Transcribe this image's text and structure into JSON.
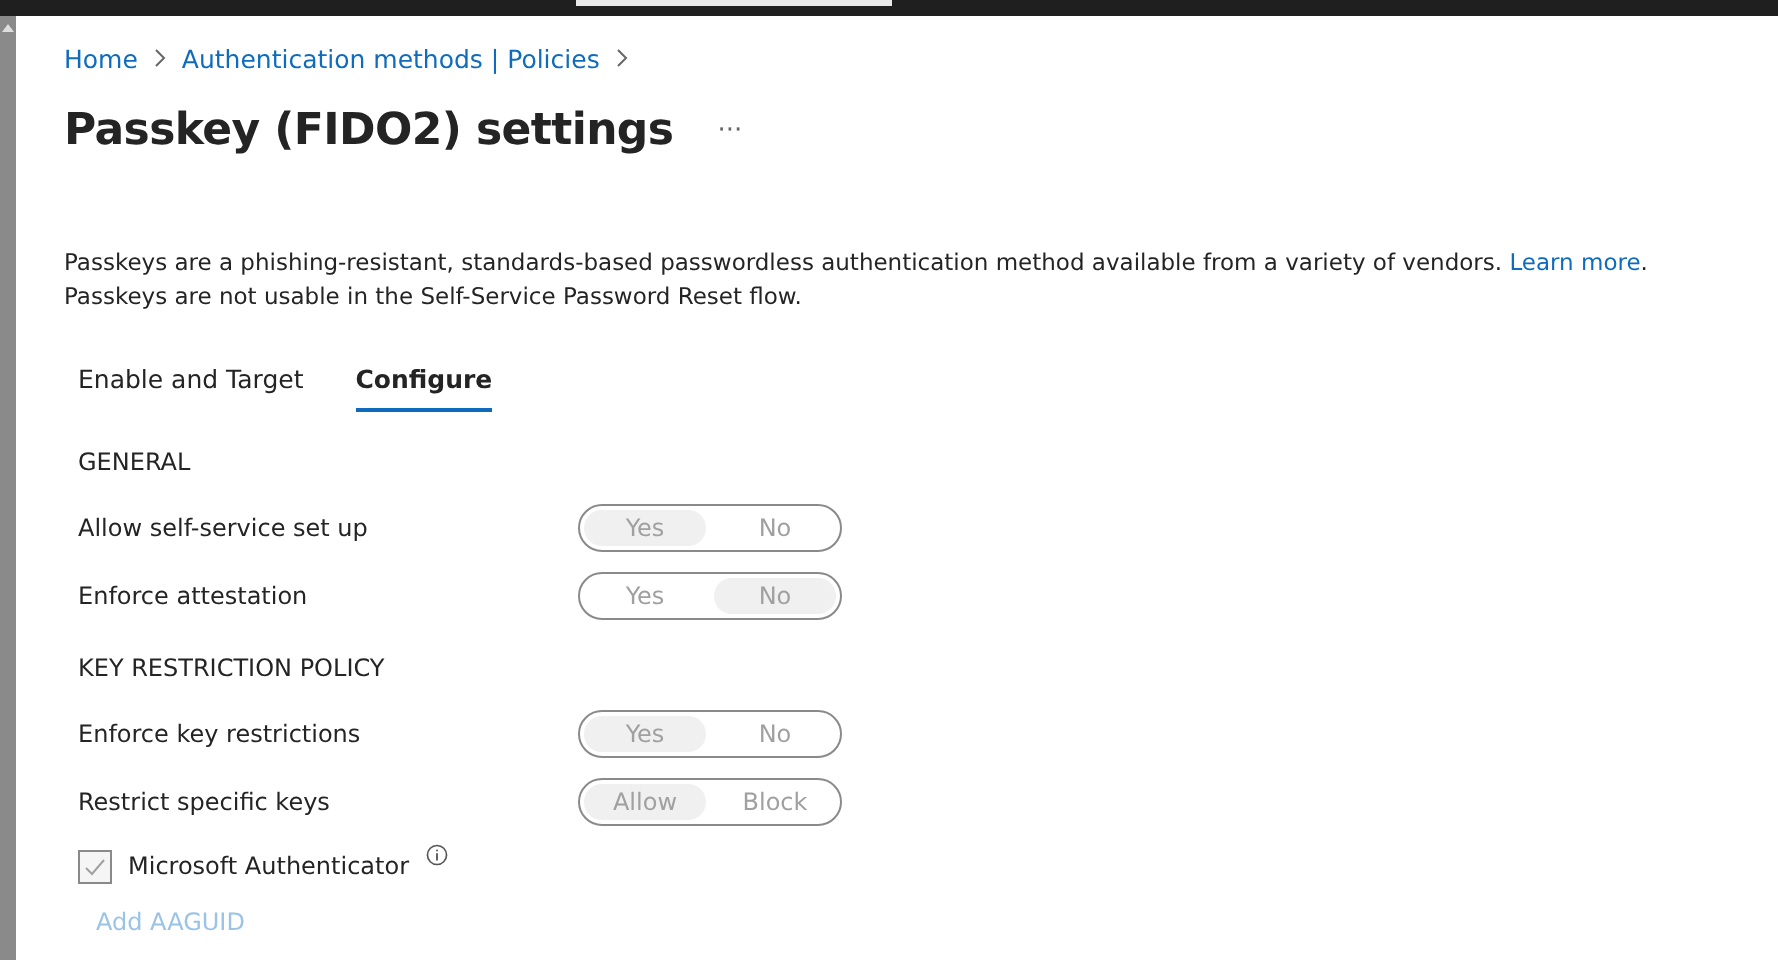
{
  "breadcrumb": [
    "Home",
    "Authentication methods | Policies"
  ],
  "title": "Passkey (FIDO2) settings",
  "more": "···",
  "description": {
    "text": "Passkeys are a phishing-resistant, standards-based passwordless authentication method available from a variety of vendors. ",
    "link": "Learn more",
    "after": ".",
    "line2": "Passkeys are not usable in the Self-Service Password Reset flow."
  },
  "tabs": [
    {
      "label": "Enable and Target",
      "selected": false
    },
    {
      "label": "Configure",
      "selected": true
    }
  ],
  "settings": [
    {
      "kind": "heading",
      "label": "GENERAL"
    },
    {
      "kind": "toggle",
      "label": "Allow self-service set up",
      "options": [
        {
          "label": "Yes",
          "selected": true
        },
        {
          "label": "No",
          "selected": false
        }
      ],
      "disabled": true
    },
    {
      "kind": "toggle",
      "label": "Enforce attestation",
      "options": [
        {
          "label": "Yes",
          "selected": false
        },
        {
          "label": "No",
          "selected": true
        }
      ],
      "disabled": true
    },
    {
      "kind": "heading",
      "label": "KEY RESTRICTION POLICY"
    },
    {
      "kind": "toggle",
      "label": "Enforce key restrictions",
      "options": [
        {
          "label": "Yes",
          "selected": true
        },
        {
          "label": "No",
          "selected": false
        }
      ],
      "disabled": true
    },
    {
      "kind": "toggle",
      "label": "Restrict specific keys",
      "options": [
        {
          "label": "Allow",
          "selected": true
        },
        {
          "label": "Block",
          "selected": false
        }
      ],
      "disabled": true
    },
    {
      "kind": "checkbox",
      "label": "Microsoft Authenticator",
      "checked": true,
      "disabled": true,
      "info": true
    },
    {
      "kind": "link",
      "label": "Add AAGUID",
      "disabled": true
    }
  ]
}
